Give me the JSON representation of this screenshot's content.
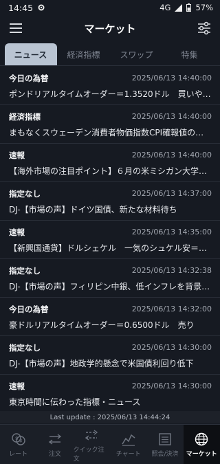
{
  "status": {
    "time": "14:45",
    "network": "4G",
    "battery": "57%"
  },
  "header": {
    "title": "マーケット"
  },
  "tabs": [
    {
      "label": "ニュース",
      "active": true
    },
    {
      "label": "経済指標",
      "active": false
    },
    {
      "label": "スワップ",
      "active": false
    },
    {
      "label": "特集",
      "active": false
    }
  ],
  "news": [
    {
      "category": "今日の為替",
      "date": "2025/06/13 14:40:00",
      "title": "ポンドリアルタイムオーダー＝1.3520ドル　買いやや…"
    },
    {
      "category": "経済指標",
      "date": "2025/06/13 14:40:00",
      "title": "まもなくスウェーデン消費者物価指数CPI確報値の発表"
    },
    {
      "category": "速報",
      "date": "2025/06/13 14:40:00",
      "title": "【海外市場の注目ポイント】６月の米ミシガン大学消…"
    },
    {
      "category": "指定なし",
      "date": "2025/06/13 14:37:00",
      "title": "DJ-【市場の声】ドイツ国債、新たな材料待ち"
    },
    {
      "category": "速報",
      "date": "2025/06/13 14:35:00",
      "title": "【新興国通貨】ドルシェケル　一気のシュケル安＝イ…"
    },
    {
      "category": "指定なし",
      "date": "2025/06/13 14:32:38",
      "title": "DJ-【市場の声】フィリピン中銀、低インフレを背景…"
    },
    {
      "category": "今日の為替",
      "date": "2025/06/13 14:32:00",
      "title": "豪ドルリアルタイムオーダー＝0.6500ドル　売り"
    },
    {
      "category": "指定なし",
      "date": "2025/06/13 14:30:00",
      "title": "DJ-【市場の声】地政学的懸念で米国債利回り低下"
    },
    {
      "category": "速報",
      "date": "2025/06/13 14:30:00",
      "title": "東京時間に伝わった指標・ニュース"
    }
  ],
  "last_update": "Last update : 2025/06/13 14:44:24",
  "bottom_nav": [
    {
      "label": "レート",
      "icon": "rate-icon",
      "active": false
    },
    {
      "label": "注文",
      "icon": "order-icon",
      "active": false
    },
    {
      "label": "クイック注文",
      "icon": "quick-order-icon",
      "active": false
    },
    {
      "label": "チャート",
      "icon": "chart-icon",
      "active": false
    },
    {
      "label": "照会/決済",
      "icon": "inquiry-icon",
      "active": false
    },
    {
      "label": "マーケット",
      "icon": "globe-icon",
      "active": true
    }
  ],
  "colors": {
    "background": "#161a22",
    "tab_active": "#b9c4d2",
    "nav_active": "#0d0f13"
  }
}
